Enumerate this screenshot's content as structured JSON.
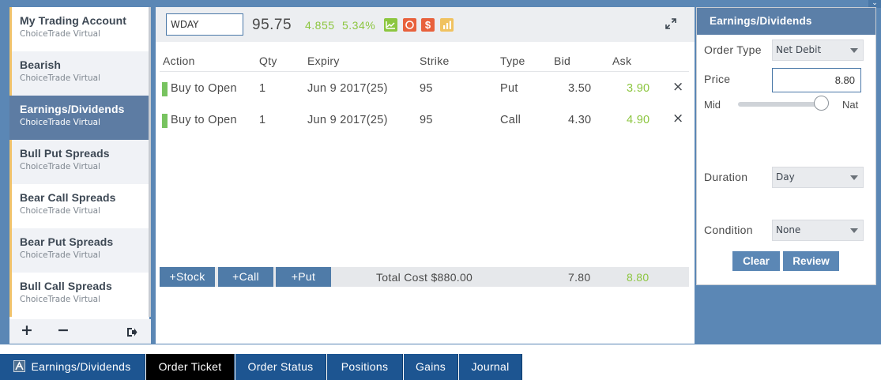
{
  "accounts": [
    {
      "name": "My Trading Account",
      "sub": "ChoiceTrade Virtual",
      "active": false
    },
    {
      "name": "Bearish",
      "sub": "ChoiceTrade Virtual",
      "active": false
    },
    {
      "name": "Earnings/Dividends",
      "sub": "ChoiceTrade Virtual",
      "active": true
    },
    {
      "name": "Bull Put Spreads",
      "sub": "ChoiceTrade Virtual",
      "active": false
    },
    {
      "name": "Bear Call Spreads",
      "sub": "ChoiceTrade Virtual",
      "active": false
    },
    {
      "name": "Bear Put Spreads",
      "sub": "ChoiceTrade Virtual",
      "active": false
    },
    {
      "name": "Bull Call Spreads",
      "sub": "ChoiceTrade Virtual",
      "active": false
    }
  ],
  "sidebar_footer": {
    "add": "+",
    "remove": "−",
    "logout_icon": "logout-icon"
  },
  "quote": {
    "symbol": "WDAY",
    "last": "95.75",
    "change": "4.855",
    "change_pct": "5.34%",
    "icons": [
      "chart-icon",
      "circle-icon",
      "dollar-icon",
      "bar-chart-icon"
    ],
    "colors": {
      "up": "#8cc63f",
      "chart": "#8cc63f",
      "circle": "#e8613c",
      "dollar": "#e8613c",
      "bar": "#f0c260"
    }
  },
  "legs": {
    "headers": {
      "action": "Action",
      "qty": "Qty",
      "expiry": "Expiry",
      "strike": "Strike",
      "type": "Type",
      "bid": "Bid",
      "ask": "Ask"
    },
    "rows": [
      {
        "action": "Buy to Open",
        "qty": "1",
        "expiry": "Jun 9 2017(25)",
        "strike": "95",
        "type": "Put",
        "bid": "3.50",
        "ask": "3.90",
        "remove": "×"
      },
      {
        "action": "Buy to Open",
        "qty": "1",
        "expiry": "Jun 9 2017(25)",
        "strike": "95",
        "type": "Call",
        "bid": "4.30",
        "ask": "4.90",
        "remove": "×"
      }
    ]
  },
  "footer_bar": {
    "add_stock": "+Stock",
    "add_call": "+Call",
    "add_put": "+Put",
    "total_cost": "Total Cost $880.00",
    "total_bid": "7.80",
    "total_ask": "8.80"
  },
  "order": {
    "title": "Earnings/Dividends",
    "order_type_label": "Order Type",
    "order_type_value": "Net Debit",
    "price_label": "Price",
    "price_value": "8.80",
    "mid_label": "Mid",
    "nat_label": "Nat",
    "slider_position": 1.0,
    "duration_label": "Duration",
    "duration_value": "Day",
    "condition_label": "Condition",
    "condition_value": "None",
    "clear": "Clear",
    "review": "Review"
  },
  "tabs": [
    {
      "label": "Earnings/Dividends",
      "icon": "account-icon",
      "active": false
    },
    {
      "label": "Order Ticket",
      "active": true
    },
    {
      "label": "Order Status",
      "active": false
    },
    {
      "label": "Positions",
      "active": false
    },
    {
      "label": "Gains",
      "active": false
    },
    {
      "label": "Journal",
      "active": false
    }
  ]
}
